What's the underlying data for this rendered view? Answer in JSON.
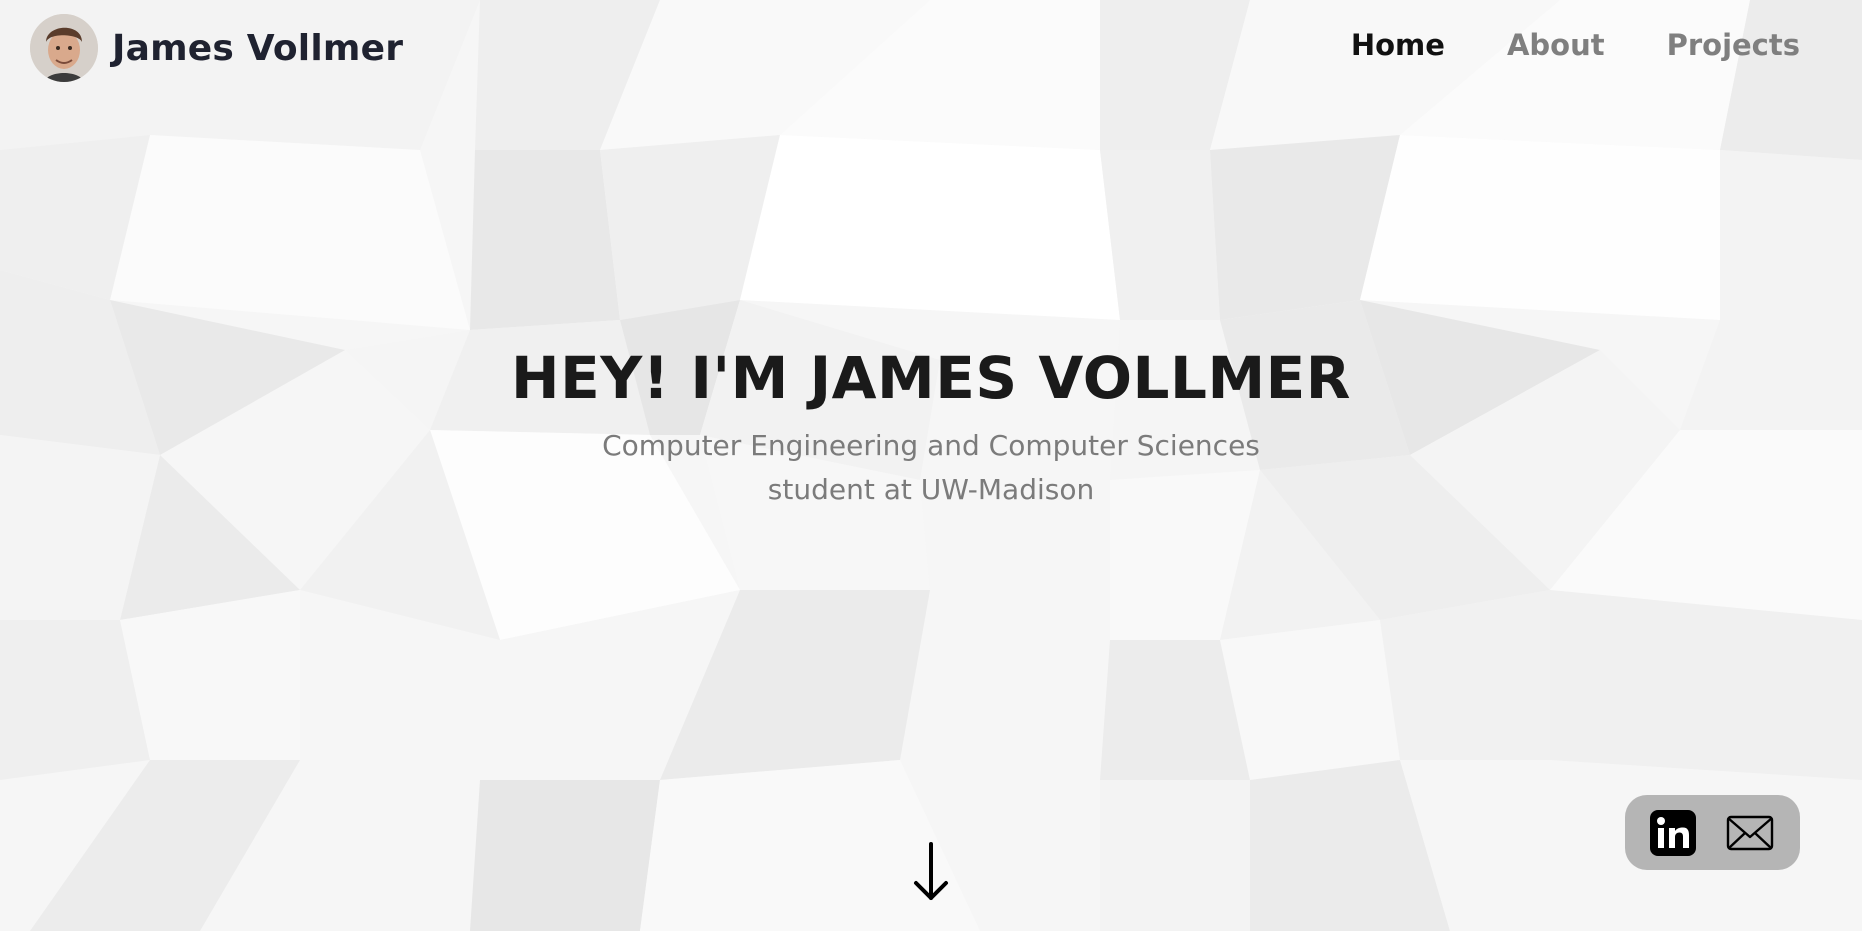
{
  "header": {
    "brand_name": "James Vollmer",
    "avatar_icon": "profile-photo",
    "nav": [
      {
        "label": "Home",
        "active": true
      },
      {
        "label": "About",
        "active": false
      },
      {
        "label": "Projects",
        "active": false
      }
    ]
  },
  "hero": {
    "title": "HEY! I'M JAMES VOLLMER",
    "subtitle": "Computer Engineering and Computer Sciences student at UW-Madison"
  },
  "scroll": {
    "icon": "arrow-down-icon"
  },
  "social": {
    "icons": [
      "linkedin-icon",
      "mail-icon"
    ]
  },
  "colors": {
    "background": "#f5f5f5",
    "nav_active": "#111111",
    "nav_inactive": "#7f7f7f",
    "subtitle": "#7b7b7b",
    "social_bar": "#b5b5b5"
  }
}
